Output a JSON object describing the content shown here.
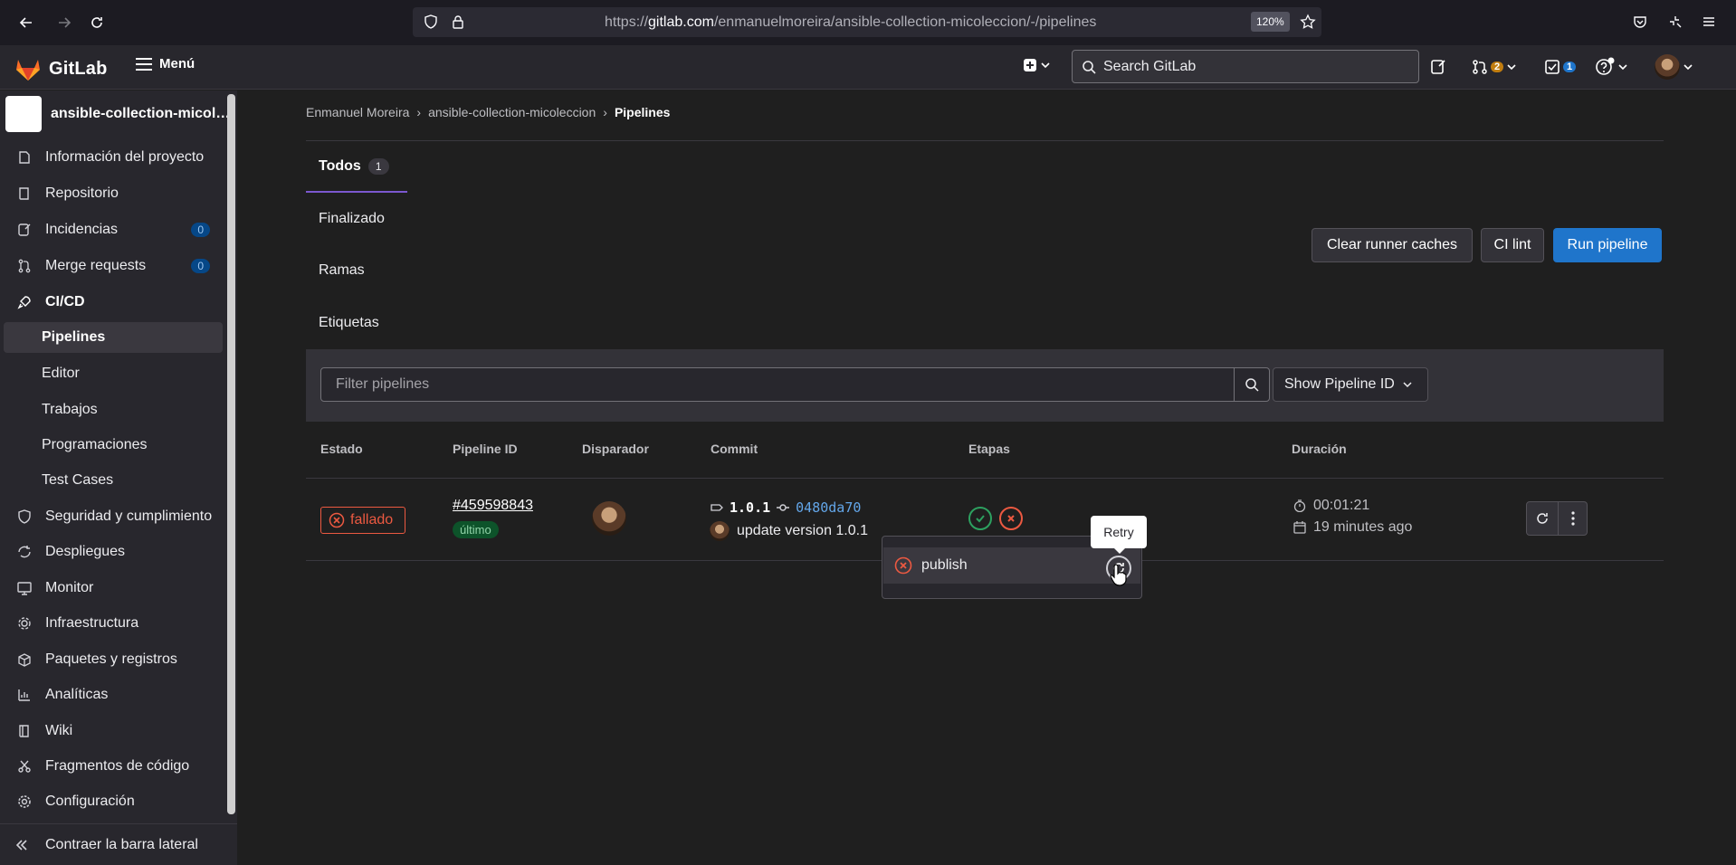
{
  "browser": {
    "url_prefix": "https://",
    "url_host": "gitlab.com",
    "url_path": "/enmanuelmoreira/ansible-collection-micoleccion/-/pipelines",
    "zoom": "120%"
  },
  "topbar": {
    "logo_text": "GitLab",
    "menu_label": "Menú",
    "search_placeholder": "Search GitLab",
    "merge_requests_count": "2",
    "todos_count": "1"
  },
  "sidebar": {
    "project_name": "ansible-collection-micoleccion",
    "items": [
      {
        "label": "Información del proyecto"
      },
      {
        "label": "Repositorio"
      },
      {
        "label": "Incidencias",
        "count": "0"
      },
      {
        "label": "Merge requests",
        "count": "0"
      },
      {
        "label": "CI/CD"
      },
      {
        "label": "Pipelines"
      },
      {
        "label": "Editor"
      },
      {
        "label": "Trabajos"
      },
      {
        "label": "Programaciones"
      },
      {
        "label": "Test Cases"
      },
      {
        "label": "Seguridad y cumplimiento"
      },
      {
        "label": "Despliegues"
      },
      {
        "label": "Monitor"
      },
      {
        "label": "Infraestructura"
      },
      {
        "label": "Paquetes y registros"
      },
      {
        "label": "Analíticas"
      },
      {
        "label": "Wiki"
      },
      {
        "label": "Fragmentos de código"
      },
      {
        "label": "Configuración"
      }
    ],
    "collapse_label": "Contraer la barra lateral"
  },
  "breadcrumb": [
    "Enmanuel Moreira",
    "ansible-collection-micoleccion",
    "Pipelines"
  ],
  "tabs": [
    {
      "label": "Todos",
      "count": "1"
    },
    {
      "label": "Finalizado"
    },
    {
      "label": "Ramas"
    },
    {
      "label": "Etiquetas"
    }
  ],
  "actions": {
    "clear_cache": "Clear runner caches",
    "ci_lint": "CI lint",
    "run_pipeline": "Run pipeline"
  },
  "filter": {
    "placeholder": "Filter pipelines",
    "show_id": "Show Pipeline ID"
  },
  "table": {
    "headers": [
      "Estado",
      "Pipeline ID",
      "Disparador",
      "Commit",
      "Etapas",
      "Duración"
    ],
    "rows": [
      {
        "status": "fallado",
        "pipeline_id": "#459598843",
        "latest": "último",
        "tag": "1.0.1",
        "sha": "0480da70",
        "commit_title": "update version 1.0.1",
        "duration": "00:01:21",
        "finished": "19 minutes ago"
      }
    ]
  },
  "stage_dropdown": {
    "job_name": "publish",
    "tooltip": "Retry"
  },
  "colors": {
    "accent": "#1f75cb",
    "failed": "#ec5941",
    "success": "#2da160"
  }
}
